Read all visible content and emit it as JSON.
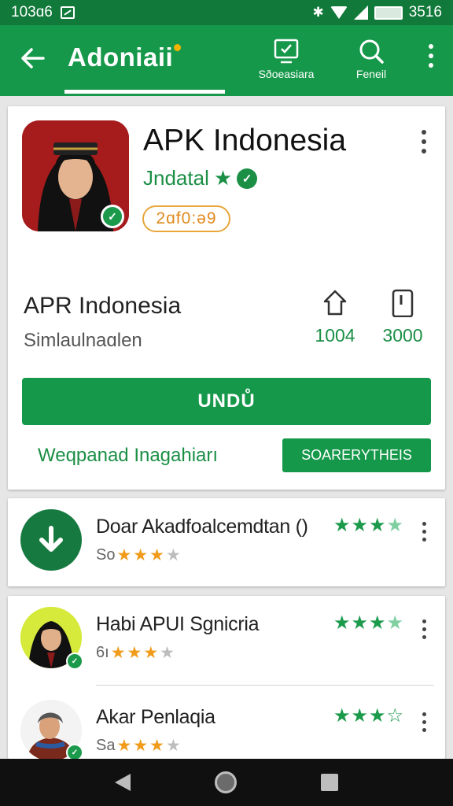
{
  "status_bar": {
    "time": "103ɑ6",
    "battery": "3516"
  },
  "app_bar": {
    "title": "Adoniaii",
    "actions": [
      {
        "label": "Sðoeasiara",
        "icon": "suggestion-icon"
      },
      {
        "label": "Feneil",
        "icon": "search-icon"
      }
    ]
  },
  "app": {
    "title": "APK Indonesia",
    "developer": "Jndatal",
    "rating_pill": "2ɑf0:ə9",
    "name": "APR Indonesia",
    "category": "Simlaulnaɑlen",
    "stats": [
      {
        "value": "1004",
        "icon": "star-outline-icon"
      },
      {
        "value": "3000",
        "icon": "download-size-icon"
      }
    ],
    "install_label": "UNDŮ",
    "link_label": "Weqpanad Inagahiarı",
    "secondary_label": "SOARERYTHEIS"
  },
  "recommendations": [
    {
      "title": "Doar Akadfoalcemdtan ()",
      "sub": "So",
      "icon": "download-icon",
      "rating": 3.5
    },
    {
      "title": "Habi APUI Sgnicria",
      "sub": "6ı",
      "icon": "avatar",
      "rating": 3.5
    },
    {
      "title": "Akar Penlaqia",
      "sub": "Sa",
      "icon": "avatar",
      "rating": 3.5
    }
  ],
  "colors": {
    "primary": "#16984a",
    "status": "#117a3a",
    "accent": "#e8a63a"
  }
}
